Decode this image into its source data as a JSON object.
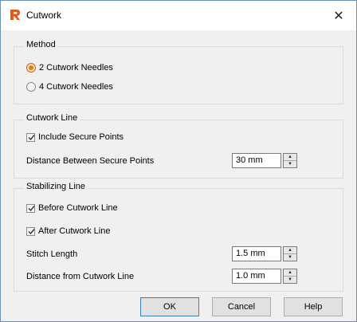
{
  "window": {
    "title": "Cutwork"
  },
  "method": {
    "title": "Method",
    "options": [
      {
        "label": "2 Cutwork Needles",
        "selected": true
      },
      {
        "label": "4 Cutwork Needles",
        "selected": false
      }
    ]
  },
  "cutwork_line": {
    "title": "Cutwork Line",
    "include_secure_points": {
      "label": "Include Secure Points",
      "checked": true
    },
    "distance_label": "Distance Between Secure Points",
    "distance_value": "30 mm"
  },
  "stabilizing_line": {
    "title": "Stabilizing Line",
    "before": {
      "label": "Before Cutwork Line",
      "checked": true
    },
    "after": {
      "label": "After Cutwork Line",
      "checked": true
    },
    "stitch_length_label": "Stitch Length",
    "stitch_length_value": "1.5 mm",
    "distance_label": "Distance from Cutwork Line",
    "distance_value": "1.0 mm"
  },
  "buttons": {
    "ok": "OK",
    "cancel": "Cancel",
    "help": "Help"
  },
  "colors": {
    "accent": "#e07c1a",
    "icon": "#e05a1a",
    "border": "#6d8fb4"
  },
  "icons": {
    "app": "cutwork-app-icon",
    "close": "close-icon"
  }
}
